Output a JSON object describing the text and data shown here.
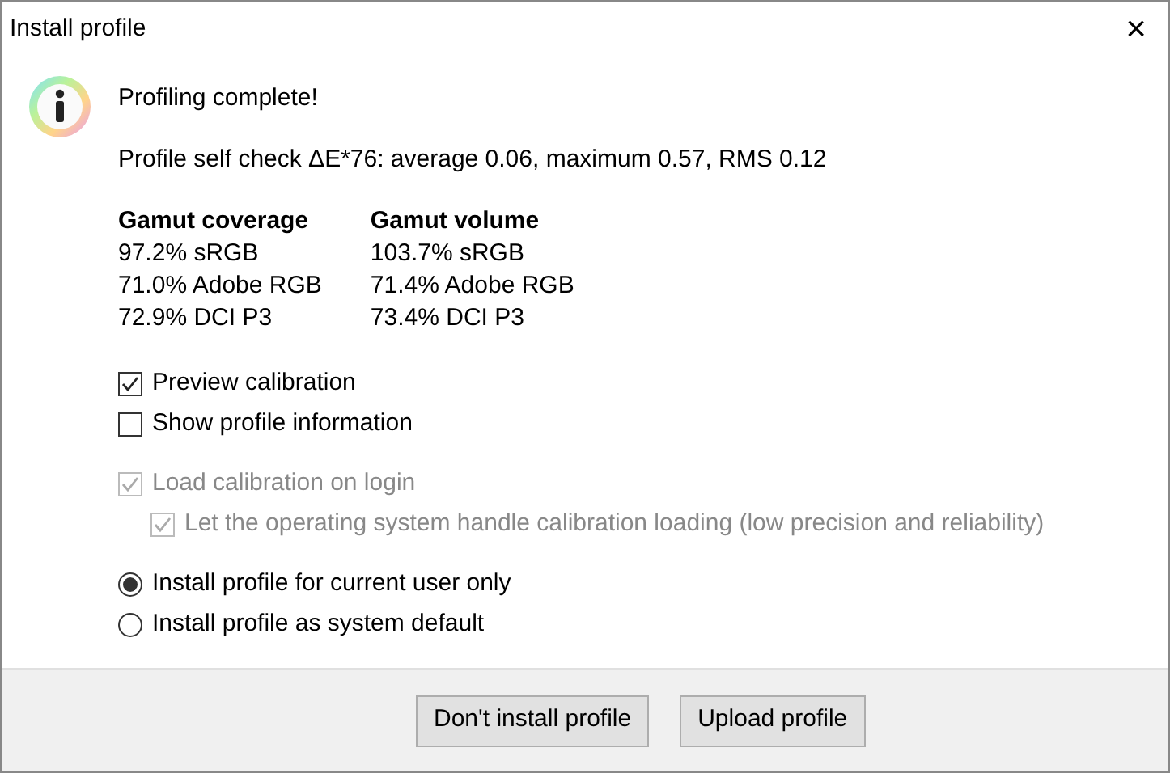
{
  "window": {
    "title": "Install profile",
    "close": "×"
  },
  "heading": "Profiling complete!",
  "self_check": "Profile self check ΔE*76: average 0.06, maximum 0.57, RMS 0.12",
  "gamut": [
    {
      "header": "Gamut coverage",
      "values": [
        "97.2% sRGB",
        "71.0% Adobe RGB",
        "72.9% DCI P3"
      ]
    },
    {
      "header": "Gamut volume",
      "values": [
        "103.7% sRGB",
        "71.4% Adobe RGB",
        "73.4% DCI P3"
      ]
    }
  ],
  "checkbox_groups": [
    [
      {
        "label": "Preview calibration",
        "checked": true,
        "disabled": false
      },
      {
        "label": "Show profile information",
        "checked": false,
        "disabled": false
      }
    ],
    [
      {
        "label": "Load calibration on login",
        "checked": true,
        "disabled": true,
        "children": [
          {
            "label": "Let the operating system handle calibration loading (low precision and reliability)",
            "checked": true,
            "disabled": true
          }
        ]
      }
    ]
  ],
  "radios": [
    {
      "label": "Install profile for current user only",
      "selected": true
    },
    {
      "label": "Install profile as system default",
      "selected": false
    }
  ],
  "buttons": [
    "Don't install profile",
    "Upload profile"
  ]
}
